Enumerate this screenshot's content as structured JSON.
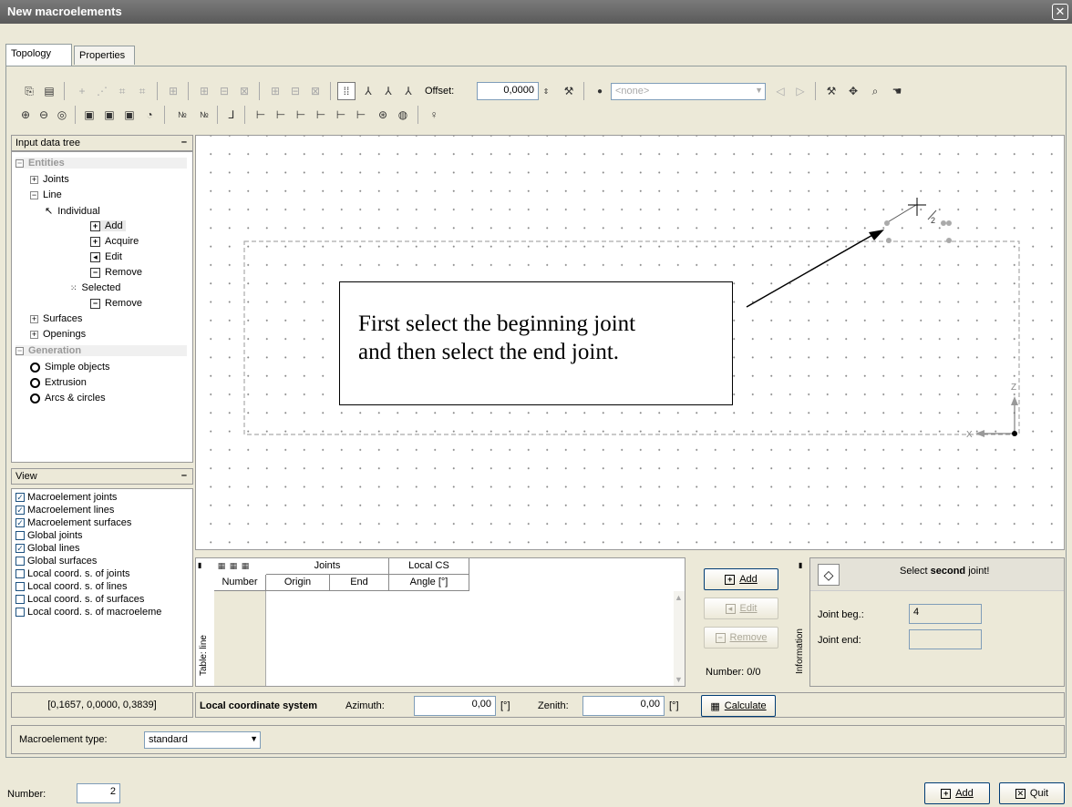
{
  "window": {
    "title": "New macroelements",
    "close_symbol": "✕"
  },
  "tabs": [
    {
      "label": "Topology"
    },
    {
      "label": "Properties"
    }
  ],
  "toolbar": {
    "offset_label": "Offset:",
    "offset_value": "0,0000",
    "layer_select_value": "<none>"
  },
  "tree": {
    "header": "Input data tree",
    "items": {
      "entities": "Entities",
      "joints": "Joints",
      "line": "Line",
      "individual": "Individual",
      "add": "Add",
      "acquire": "Acquire",
      "edit": "Edit",
      "remove": "Remove",
      "selected": "Selected",
      "remove2": "Remove",
      "surfaces": "Surfaces",
      "openings": "Openings",
      "generation": "Generation",
      "simple_objects": "Simple objects",
      "extrusion": "Extrusion",
      "arcs_circles": "Arcs & circles"
    }
  },
  "view": {
    "header": "View",
    "options": [
      {
        "label": "Macroelement joints",
        "checked": true
      },
      {
        "label": "Macroelement lines",
        "checked": true
      },
      {
        "label": "Macroelement surfaces",
        "checked": true
      },
      {
        "label": "Global joints",
        "checked": false
      },
      {
        "label": "Global lines",
        "checked": true
      },
      {
        "label": "Global surfaces",
        "checked": false
      },
      {
        "label": "Local coord. s. of joints",
        "checked": false
      },
      {
        "label": "Local coord. s. of lines",
        "checked": false
      },
      {
        "label": "Local coord. s. of surfaces",
        "checked": false
      },
      {
        "label": "Local coord. s. of macroeleme",
        "checked": false
      }
    ]
  },
  "canvas": {
    "callout_line1": "First select the beginning joint",
    "callout_line2": "and then select the end joint.",
    "cursor_label": "2",
    "axis_z": "Z",
    "axis_x": "X"
  },
  "table": {
    "side_label": "Table: line",
    "group_joints": "Joints",
    "group_local_cs": "Local CS",
    "col_number": "Number",
    "col_origin": "Origin",
    "col_end": "End",
    "col_angle": "Angle [°]"
  },
  "table_buttons": {
    "add": "Add",
    "edit": "Edit",
    "remove": "Remove",
    "number": "Number: 0/0"
  },
  "information": {
    "side_label": "Information",
    "message_prefix": "Select ",
    "message_bold": "second",
    "message_suffix": " joint!",
    "joint_beg_label": "Joint beg.:",
    "joint_beg_value": "4",
    "joint_end_label": "Joint end:",
    "joint_end_value": ""
  },
  "status": {
    "coordinates": "[0,1657, 0,0000, 0,3839]"
  },
  "lcs": {
    "title": "Local coordinate system",
    "azimuth_label": "Azimuth:",
    "azimuth_value": "0,00",
    "azimuth_unit": "[°]",
    "zenith_label": "Zenith:",
    "zenith_value": "0,00",
    "zenith_unit": "[°]",
    "calculate_label": "Calculate"
  },
  "macro": {
    "type_label": "Macroelement type:",
    "type_value": "standard"
  },
  "footer": {
    "number_label": "Number:",
    "number_value": "2",
    "add_label": "Add",
    "quit_label": "Quit"
  },
  "colors": {
    "titlebar": "#6d6d6d",
    "panel": "#ece9d8",
    "section_text": "#999999",
    "info_background": "#ece9d8"
  }
}
